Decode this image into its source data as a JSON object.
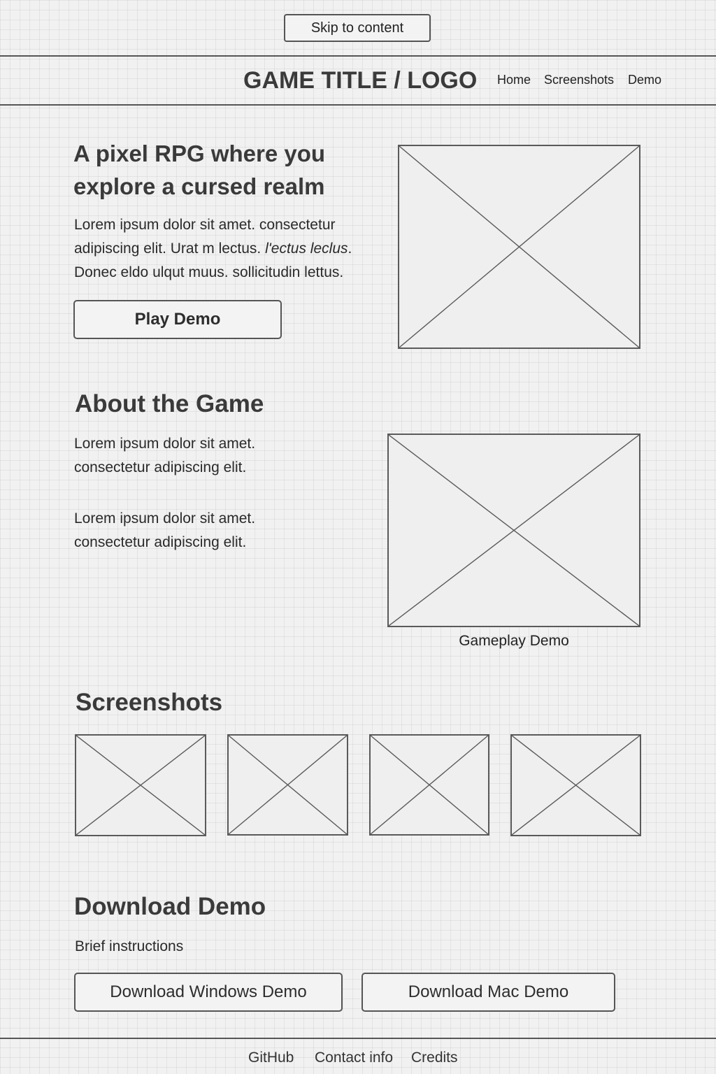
{
  "skip_link": "Skip to content",
  "header": {
    "logo": "GAME TITLE / LOGO",
    "nav": [
      "Home",
      "Screenshots",
      "Demo"
    ]
  },
  "hero": {
    "title": "A pixel RPG where you explore a cursed realm",
    "text_before_italic": "Lorem ipsum dolor sit amet. consectetur adipiscing elit. Urat m lectus. ",
    "text_italic": "l'ectus leclus",
    "text_after_italic": ". Donec eldo ulqut muus. sollicitudin lettus.",
    "button": "Play Demo"
  },
  "about": {
    "title": "About the Game",
    "paragraphs": [
      "Lorem ipsum dolor sit amet. consectetur adipiscing elit.",
      "Lorem ipsum dolor sit amet. consectetur adipiscing elit."
    ],
    "video_caption": "Gameplay Demo"
  },
  "screenshots": {
    "title": "Screenshots"
  },
  "download": {
    "title": "Download Demo",
    "instructions": "Brief instructions",
    "windows_button": "Download Windows Demo",
    "mac_button": "Download Mac Demo"
  },
  "footer": {
    "links": [
      "GitHub",
      "Contact info",
      "Credits"
    ]
  }
}
